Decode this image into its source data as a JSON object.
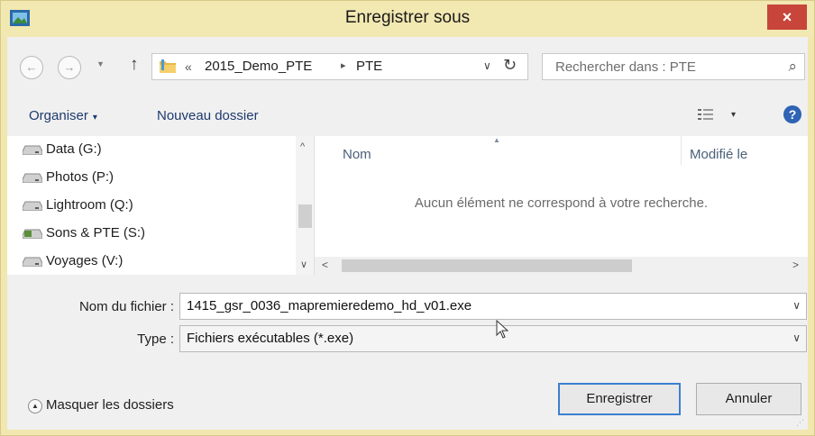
{
  "window": {
    "title": "Enregistrer sous",
    "close_label": "×",
    "accent_close_color": "#c7453a",
    "title_bar_color": "#f2e8b2"
  },
  "navigation": {
    "back_icon": "back-arrow-icon",
    "forward_icon": "forward-arrow-icon",
    "up_icon": "up-arrow-icon"
  },
  "address": {
    "overflow": "«",
    "crumbs": [
      "2015_Demo_PTE",
      "PTE"
    ],
    "separator": "▸",
    "dropdown": "∨",
    "refresh": "↻"
  },
  "search": {
    "placeholder": "Rechercher dans : PTE",
    "icon": "search-icon"
  },
  "toolbar": {
    "organiser": "Organiser",
    "organiser_caret": "▾",
    "nouveau_dossier": "Nouveau dossier",
    "view_caret": "▾",
    "help": "?"
  },
  "nav_pane": {
    "items": [
      {
        "label": "Data (G:)",
        "icon": "drive-icon"
      },
      {
        "label": "Photos (P:)",
        "icon": "drive-icon"
      },
      {
        "label": "Lightroom (Q:)",
        "icon": "drive-icon"
      },
      {
        "label": "Sons & PTE (S:)",
        "icon": "network-drive-icon"
      },
      {
        "label": "Voyages (V:)",
        "icon": "drive-icon"
      }
    ],
    "scroll_up": "^",
    "scroll_down": "∨"
  },
  "file_list": {
    "columns": [
      "Nom",
      "Modifié le"
    ],
    "empty_message": "Aucun élément ne correspond à votre recherche.",
    "scroll_left": "<",
    "scroll_right": ">"
  },
  "form": {
    "filename_label": "Nom du fichier :",
    "filename_value": "1415_gsr_0036_mapremieredemo_hd_v01.exe",
    "type_label": "Type :",
    "type_value": "Fichiers exécutables (*.exe)"
  },
  "footer": {
    "hide_folders": "Masquer les dossiers",
    "save_button": "Enregistrer",
    "cancel_button": "Annuler"
  }
}
